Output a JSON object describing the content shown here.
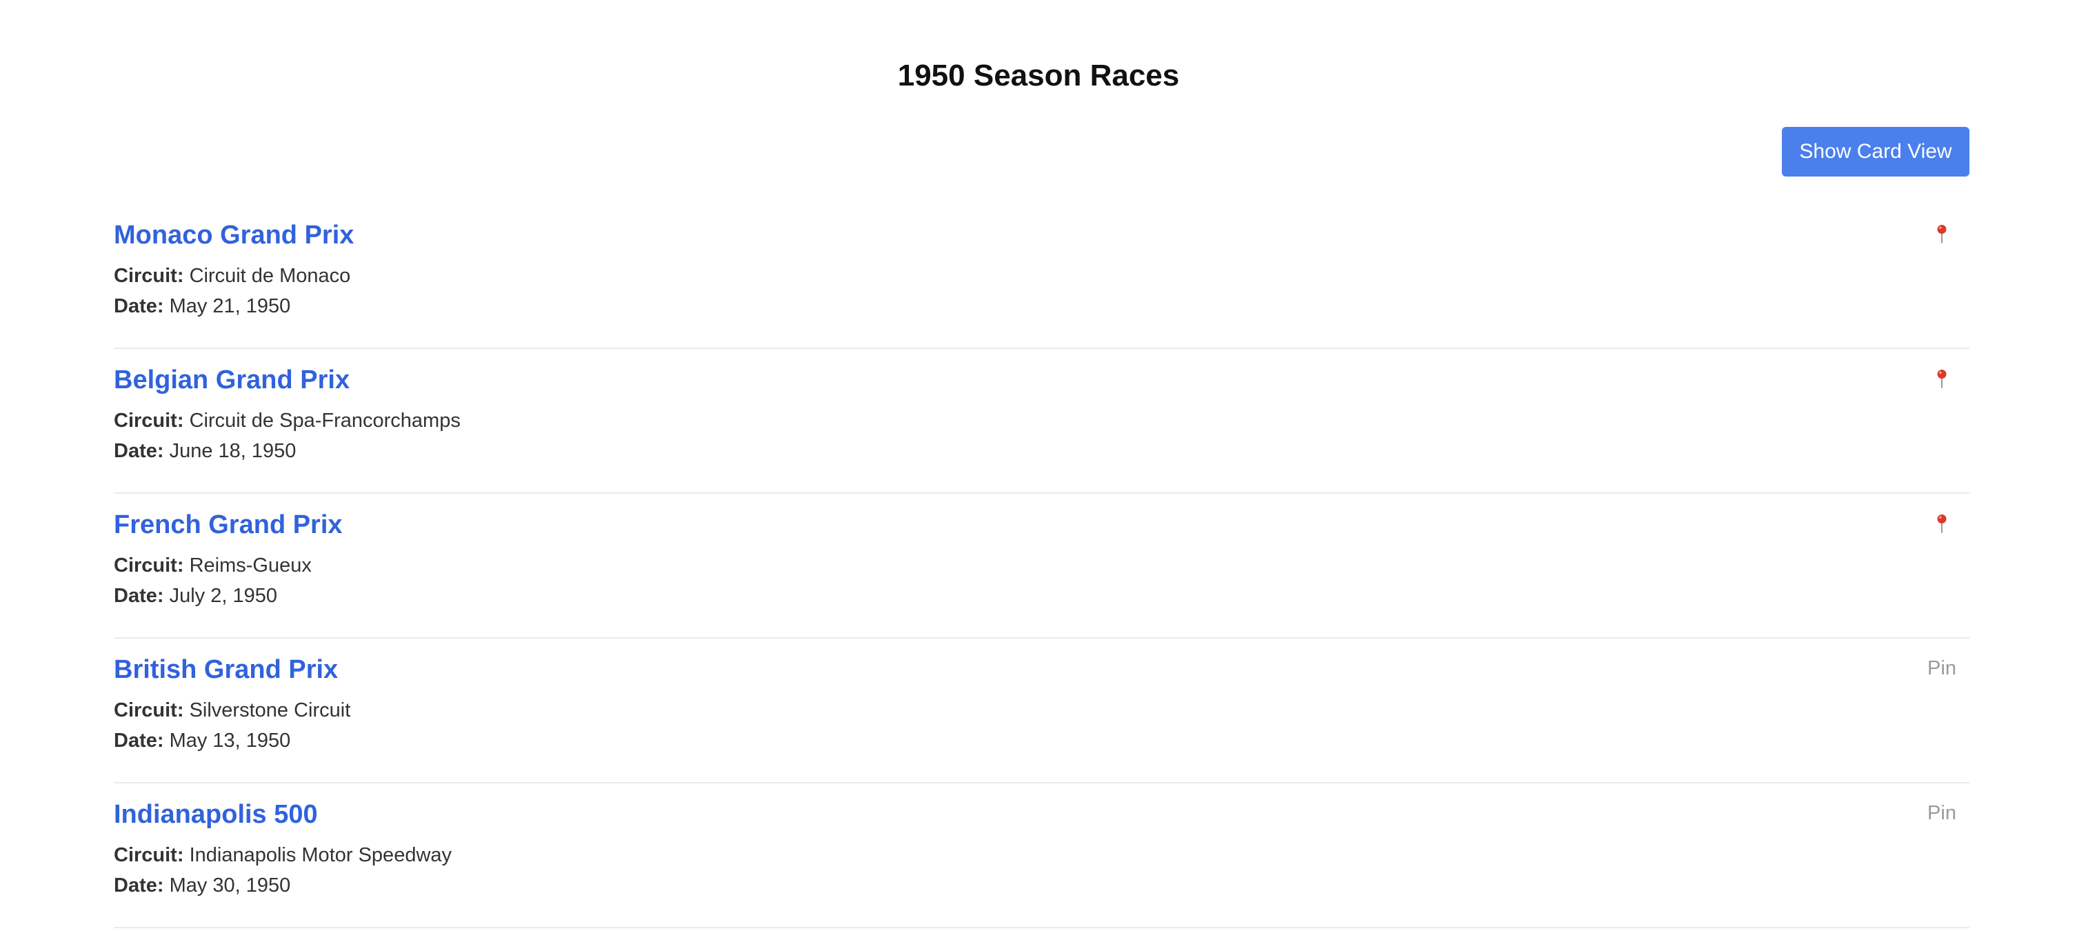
{
  "page": {
    "title": "1950 Season Races"
  },
  "toolbar": {
    "view_toggle_label": "Show Card View"
  },
  "labels": {
    "circuit": "Circuit:",
    "date": "Date:"
  },
  "colors": {
    "accent": "#4a7fec",
    "link": "#3162dc",
    "pin_icon": "#d93a2b",
    "muted": "#9a9a9a"
  },
  "races": [
    {
      "name": "Monaco Grand Prix",
      "circuit": "Circuit de Monaco",
      "date": "May 21, 1950",
      "pinned": true,
      "pin_icon": "pushpin-icon"
    },
    {
      "name": "Belgian Grand Prix",
      "circuit": "Circuit de Spa-Francorchamps",
      "date": "June 18, 1950",
      "pinned": true,
      "pin_icon": "pushpin-icon"
    },
    {
      "name": "French Grand Prix",
      "circuit": "Reims-Gueux",
      "date": "July 2, 1950",
      "pinned": true,
      "pin_icon": "pushpin-icon"
    },
    {
      "name": "British Grand Prix",
      "circuit": "Silverstone Circuit",
      "date": "May 13, 1950",
      "pinned": false,
      "pin_label": "Pin"
    },
    {
      "name": "Indianapolis 500",
      "circuit": "Indianapolis Motor Speedway",
      "date": "May 30, 1950",
      "pinned": false,
      "pin_label": "Pin"
    }
  ]
}
